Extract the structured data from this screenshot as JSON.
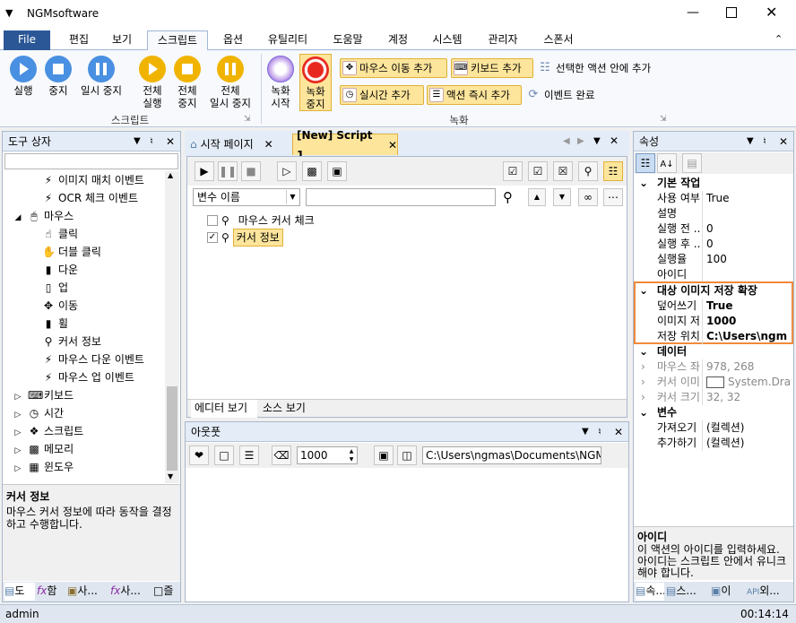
{
  "app": {
    "title": "NGMsoftware"
  },
  "menu": {
    "file": "File",
    "tabs": [
      "편집",
      "보기",
      "스크립트",
      "옵션",
      "유틸리티",
      "도움말",
      "계정",
      "시스템",
      "관리자",
      "스폰서"
    ],
    "active": "스크립트"
  },
  "ribbon": {
    "btn_run": "실행",
    "btn_stop": "중지",
    "btn_pause": "일시 중지",
    "btn_run_all_1": "전체",
    "btn_run_all_2": "실행",
    "btn_stop_all_1": "전체",
    "btn_stop_all_2": "중지",
    "btn_pause_all_1": "전체",
    "btn_pause_all_2": "일시 중지",
    "group_script": "스크립트",
    "btn_rec_start_1": "녹화",
    "btn_rec_start_2": "시작",
    "btn_rec_stop_1": "녹화",
    "btn_rec_stop_2": "중지",
    "add_mouse": "마우스 이동 추가",
    "add_keyboard": "키보드 추가",
    "add_realtime": "실시간 추가",
    "add_action_now": "액션 즉시 추가",
    "add_in_selected": "선택한 액션 안에 추가",
    "event_done": "이벤트 완료",
    "group_record": "녹화"
  },
  "toolbox": {
    "title": "도구 상자",
    "items": [
      {
        "label": "이미지 매치 이벤트",
        "icon": "bolt-icon"
      },
      {
        "label": "OCR 체크 이벤트",
        "icon": "bolt-icon"
      },
      {
        "label": "마우스",
        "icon": "mouse-icon"
      },
      {
        "label": "클릭",
        "icon": "mouse-click-icon"
      },
      {
        "label": "더블 클릭",
        "icon": "mouse-double-click-icon"
      },
      {
        "label": "다운",
        "icon": "mouse-down-icon"
      },
      {
        "label": "업",
        "icon": "mouse-up-icon"
      },
      {
        "label": "이동",
        "icon": "move-icon"
      },
      {
        "label": "휠",
        "icon": "mouse-wheel-icon"
      },
      {
        "label": "커서 정보",
        "icon": "cursor-info-icon"
      },
      {
        "label": "마우스 다운 이벤트",
        "icon": "bolt-icon"
      },
      {
        "label": "마우스 업 이벤트",
        "icon": "bolt-icon"
      },
      {
        "label": "키보드",
        "icon": "keyboard-icon"
      },
      {
        "label": "시간",
        "icon": "clock-icon"
      },
      {
        "label": "스크립트",
        "icon": "script-icon"
      },
      {
        "label": "메모리",
        "icon": "memory-icon"
      },
      {
        "label": "윈도우",
        "icon": "windows-icon"
      }
    ],
    "desc_title": "커서 정보",
    "desc_text": "마우스 커서 정보에 따라 동작을 결정하고 수행합니다.",
    "bottom_tabs": [
      "도",
      "함",
      "사...",
      "사...",
      "즐"
    ]
  },
  "doc": {
    "tab_start": "시작 페이지",
    "tab_script": "[New] Script 1",
    "var_select": "변수 이름",
    "script_items": [
      {
        "label": "마우스 커서 체크",
        "checked": false
      },
      {
        "label": "커서 정보",
        "checked": true
      }
    ],
    "view_editor": "에디터 보기",
    "view_source": "소스 보기"
  },
  "output": {
    "title": "아웃풋",
    "count": "1000",
    "path": "C:\\Users\\ngmas\\Documents\\NGM6\\"
  },
  "props": {
    "title": "속성",
    "cat1": "기본 작업",
    "rows1": [
      {
        "name": "사용 여부",
        "value": "True"
      },
      {
        "name": "설명",
        "value": ""
      },
      {
        "name": "실행 전 ...",
        "value": "0"
      },
      {
        "name": "실행 후 ...",
        "value": "0"
      },
      {
        "name": "실행율",
        "value": "100"
      },
      {
        "name": "아이디",
        "value": ""
      }
    ],
    "cat2": "대상 이미지 저장 확장",
    "rows2": [
      {
        "name": "덮어쓰기",
        "value": "True"
      },
      {
        "name": "이미지 저...",
        "value": "1000"
      },
      {
        "name": "저장 위치",
        "value": "C:\\Users\\ngm"
      }
    ],
    "cat3": "데이터",
    "rows3": [
      {
        "name": "마우스 좌...",
        "value": "978, 268"
      },
      {
        "name": "커서 이미...",
        "value": "System.Draw"
      },
      {
        "name": "커서 크기",
        "value": "32, 32"
      }
    ],
    "cat4": "변수",
    "rows4": [
      {
        "name": "가져오기",
        "value": "(컬렉션)"
      },
      {
        "name": "추가하기",
        "value": "(컬렉션)"
      }
    ],
    "desc_title": "아이디",
    "desc_text": "이 액션의 아이디를 입력하세요. 아이디는 스크립트 안에서 유니크해야 합니다.",
    "bottom_tabs": [
      "속...",
      "스...",
      "이",
      "외..."
    ]
  },
  "status": {
    "user": "admin",
    "time": "00:14:14"
  }
}
